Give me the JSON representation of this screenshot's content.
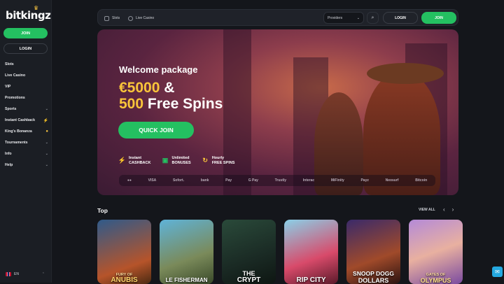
{
  "brand": {
    "logo": "bitkingz",
    "accent": "#24c061",
    "gold": "#f9c53a"
  },
  "sidebar": {
    "join_label": "JOIN",
    "login_label": "LOGIN",
    "items": [
      {
        "label": "Slots",
        "chev": ""
      },
      {
        "label": "Live Casino",
        "chev": ""
      },
      {
        "label": "VIP",
        "chev": ""
      },
      {
        "label": "Promotions",
        "chev": ""
      },
      {
        "label": "Sports",
        "chev": "⌄"
      },
      {
        "label": "Instant Cashback",
        "chev": "⚡"
      },
      {
        "label": "King's Bonanza",
        "chev": "●"
      },
      {
        "label": "Tournaments",
        "chev": "⌄"
      },
      {
        "label": "Info",
        "chev": "⌄"
      },
      {
        "label": "Help",
        "chev": "⌄"
      }
    ],
    "language": "EN"
  },
  "topbar": {
    "nav": [
      {
        "label": "Slots"
      },
      {
        "label": "Live Casino"
      }
    ],
    "providers_label": "Providers",
    "login_label": "LOGIN",
    "join_label": "JOIN"
  },
  "hero": {
    "welcome": "Welcome package",
    "amount_gold": "€5000",
    "amount_rest": "&",
    "spins_gold": "500",
    "spins_rest": "Free Spins",
    "cta": "QUICK JOIN",
    "features": [
      {
        "line1": "Instant",
        "line2": "CASHBACK",
        "icon": "⚡"
      },
      {
        "line1": "Unlimited",
        "line2": "BONUSES",
        "icon": "🎁"
      },
      {
        "line1": "Hourly",
        "line2": "FREE SPINS",
        "icon": "↻"
      }
    ],
    "payments": [
      "●●",
      "VISA",
      "Sofort.",
      "bank",
      "Pay",
      "G Pay",
      "Trustly",
      "Interac",
      "MiFinity",
      "Payz",
      "Neosurf",
      "Bitcoin"
    ]
  },
  "top": {
    "title": "Top",
    "view_all": "VIEW ALL",
    "games": [
      {
        "sub": "FURY OF",
        "name": "ANUBIS"
      },
      {
        "sub": "",
        "name": "LE FISHERMAN"
      },
      {
        "sub": "THE",
        "name": "CRYPT"
      },
      {
        "sub": "",
        "name": "RIP CITY"
      },
      {
        "sub": "SNOOP DOGG",
        "name": "DOLLARS"
      },
      {
        "sub": "GATES OF",
        "name": "OLYMPUS"
      }
    ]
  }
}
